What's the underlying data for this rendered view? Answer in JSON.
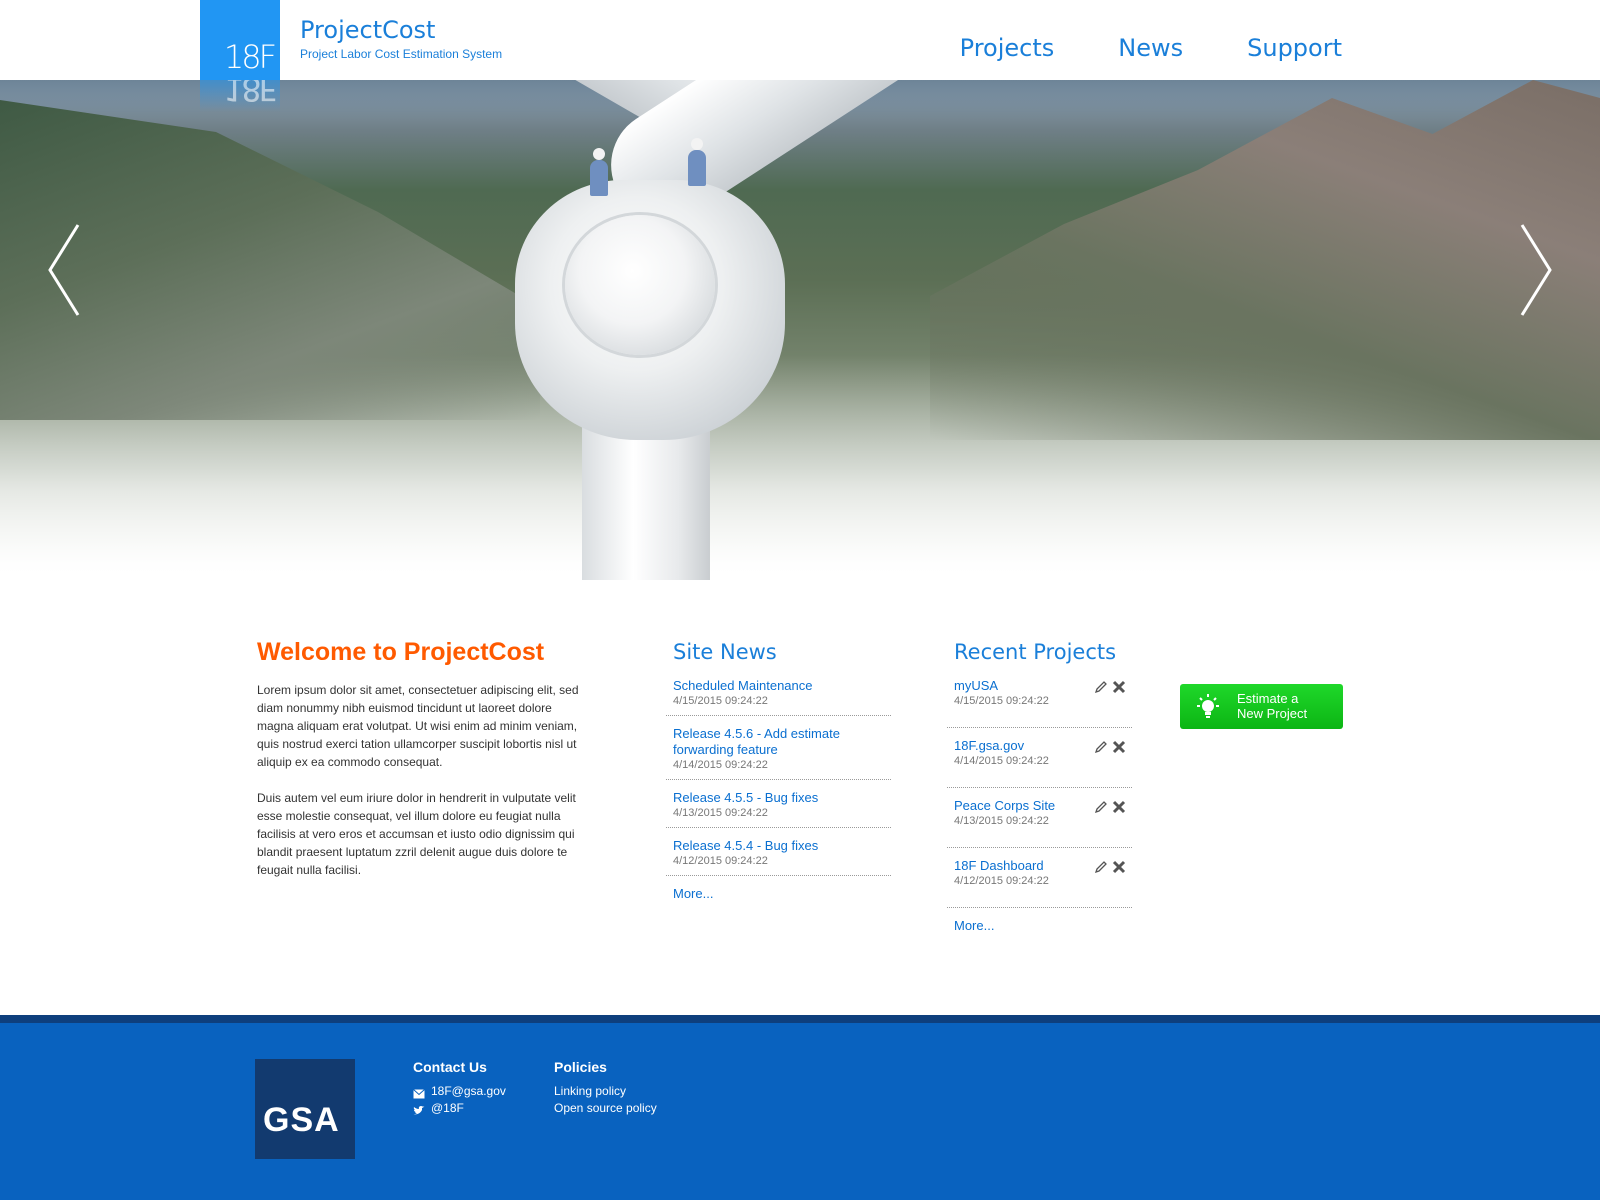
{
  "header": {
    "logo_text": "18F",
    "title": "ProjectCost",
    "subtitle": "Project Labor Cost Estimation System",
    "nav": [
      {
        "label": "Projects"
      },
      {
        "label": "News"
      },
      {
        "label": "Support"
      }
    ]
  },
  "hero": {
    "prev_icon": "chevron-left-icon",
    "next_icon": "chevron-right-icon"
  },
  "welcome": {
    "title": "Welcome to ProjectCost",
    "paragraphs": [
      "Lorem ipsum dolor sit amet, consectetuer adipiscing elit, sed diam nonummy nibh euismod tincidunt ut laoreet dolore magna aliquam erat volutpat. Ut wisi enim ad minim veniam, quis nostrud exerci tation ullamcorper suscipit lobortis nisl ut aliquip ex ea commodo consequat.",
      "Duis autem vel eum iriure dolor in hendrerit in vulputate velit esse molestie consequat, vel illum dolore eu feugiat nulla facilisis at vero eros et accumsan et iusto odio dignissim qui blandit praesent luptatum zzril delenit augue duis dolore te feugait nulla facilisi."
    ]
  },
  "news": {
    "title": "Site News",
    "items": [
      {
        "title": "Scheduled Maintenance",
        "date": "4/15/2015 09:24:22"
      },
      {
        "title": "Release 4.5.6 - Add estimate forwarding feature",
        "date": "4/14/2015 09:24:22"
      },
      {
        "title": "Release 4.5.5 - Bug fixes",
        "date": "4/13/2015 09:24:22"
      },
      {
        "title": "Release 4.5.4 - Bug fixes",
        "date": "4/12/2015 09:24:22"
      }
    ],
    "more": "More..."
  },
  "projects": {
    "title": "Recent Projects",
    "items": [
      {
        "title": "myUSA",
        "date": "4/15/2015 09:24:22"
      },
      {
        "title": "18F.gsa.gov",
        "date": "4/14/2015 09:24:22"
      },
      {
        "title": "Peace Corps Site",
        "date": "4/13/2015 09:24:22"
      },
      {
        "title": "18F Dashboard",
        "date": "4/12/2015 09:24:22"
      }
    ],
    "more": "More..."
  },
  "estimate_button": {
    "line1": "Estimate a",
    "line2": "New Project",
    "icon": "lightbulb-icon",
    "color": "#14c41d"
  },
  "footer": {
    "logo_text": "GSA",
    "contact": {
      "title": "Contact Us",
      "email": "18F@gsa.gov",
      "twitter": "@18F"
    },
    "policies": {
      "title": "Policies",
      "links": [
        "Linking policy",
        "Open source policy"
      ]
    }
  },
  "colors": {
    "brand_blue": "#2196f3",
    "link_blue": "#1a7fd9",
    "welcome_orange": "#ff5a00",
    "footer_blue": "#0962bf",
    "footer_dark": "#0e3f7d"
  }
}
